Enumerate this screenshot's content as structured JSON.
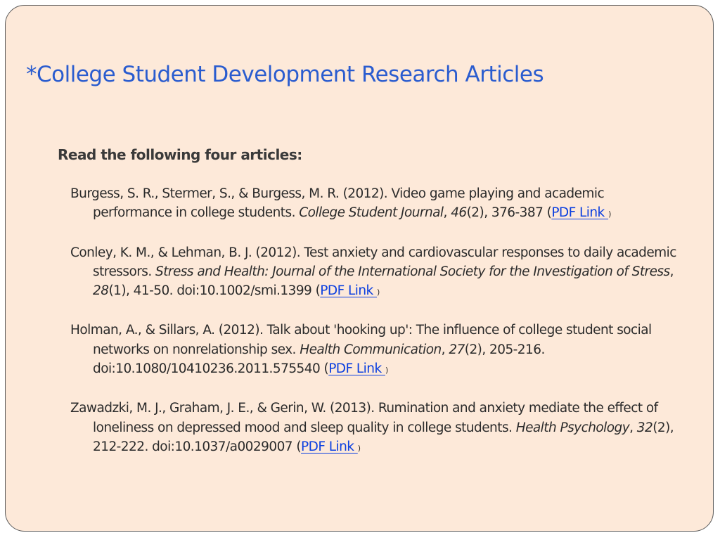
{
  "slide": {
    "title": "*College Student Development Research Articles",
    "subheading": "Read the following four articles:"
  },
  "references": [
    {
      "segments": [
        {
          "text": "Burgess, S. R., Stermer, S., & Burgess, M. R. (2012). Video game playing and academic performance in college students. ",
          "style": "normal"
        },
        {
          "text": "College Student Journal",
          "style": "italic"
        },
        {
          "text": ", ",
          "style": "normal"
        },
        {
          "text": "46",
          "style": "italic"
        },
        {
          "text": "(2), 376-387 (",
          "style": "normal"
        },
        {
          "text": "PDF Link  ",
          "style": "link"
        },
        {
          "text": ")",
          "style": "close"
        }
      ]
    },
    {
      "segments": [
        {
          "text": "Conley, K. M., & Lehman, B. J. (2012). Test anxiety and cardiovascular responses to daily academic stressors. ",
          "style": "normal"
        },
        {
          "text": "Stress and Health: Journal of the International Society for the Investigation of Stress",
          "style": "italic"
        },
        {
          "text": ", ",
          "style": "normal"
        },
        {
          "text": "28",
          "style": "italic"
        },
        {
          "text": "(1), 41-50. doi:10.1002/smi.1399 (",
          "style": "normal"
        },
        {
          "text": "PDF Link  ",
          "style": "link"
        },
        {
          "text": ")",
          "style": "close"
        }
      ]
    },
    {
      "segments": [
        {
          "text": "Holman, A., & Sillars, A. (2012). Talk about 'hooking up': The influence of college student social networks on nonrelationship sex. ",
          "style": "normal"
        },
        {
          "text": "Health Communication",
          "style": "italic"
        },
        {
          "text": ", ",
          "style": "normal"
        },
        {
          "text": "27",
          "style": "italic"
        },
        {
          "text": "(2), 205-216. doi:10.1080/10410236.2011.575540 (",
          "style": "normal"
        },
        {
          "text": "PDF Link  ",
          "style": "link"
        },
        {
          "text": ")",
          "style": "close"
        }
      ]
    },
    {
      "segments": [
        {
          "text": "Zawadzki, M. J., Graham, J. E., & Gerin, W. (2013). Rumination and anxiety mediate the effect of loneliness on depressed mood and sleep quality in college students. ",
          "style": "normal"
        },
        {
          "text": "Health Psychology",
          "style": "italic"
        },
        {
          "text": ", ",
          "style": "normal"
        },
        {
          "text": "32",
          "style": "italic"
        },
        {
          "text": "(2), 212-222. doi:10.1037/a0029007 (",
          "style": "normal"
        },
        {
          "text": "PDF Link  ",
          "style": "link"
        },
        {
          "text": ")",
          "style": "close"
        }
      ]
    }
  ]
}
